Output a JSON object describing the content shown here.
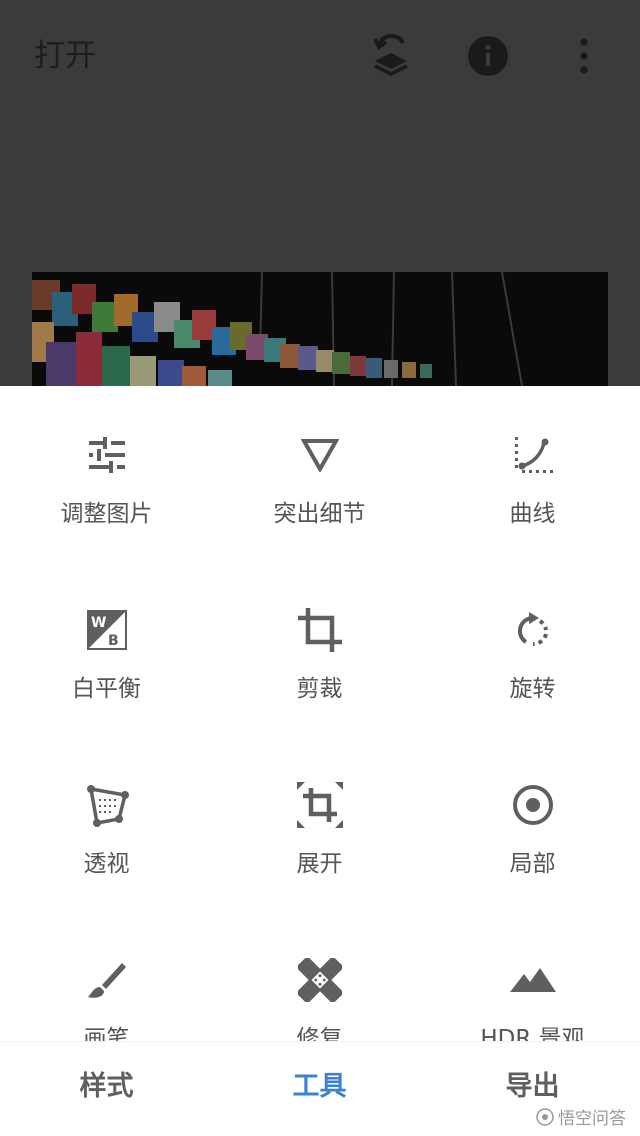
{
  "appbar": {
    "title": "打开",
    "icons": [
      "layers-undo-icon",
      "info-icon",
      "more-vert-icon"
    ]
  },
  "tools": [
    {
      "label": "调整图片",
      "icon": "tune-sliders-icon"
    },
    {
      "label": "突出细节",
      "icon": "details-triangle-icon"
    },
    {
      "label": "曲线",
      "icon": "curves-icon"
    },
    {
      "label": "白平衡",
      "icon": "white-balance-icon"
    },
    {
      "label": "剪裁",
      "icon": "crop-icon"
    },
    {
      "label": "旋转",
      "icon": "rotate-icon"
    },
    {
      "label": "透视",
      "icon": "perspective-icon"
    },
    {
      "label": "展开",
      "icon": "expand-icon"
    },
    {
      "label": "局部",
      "icon": "selective-icon"
    },
    {
      "label": "画笔",
      "icon": "brush-icon"
    },
    {
      "label": "修复",
      "icon": "healing-icon"
    },
    {
      "label": "HDR 景观",
      "icon": "hdr-landscape-icon"
    }
  ],
  "nav": {
    "tabs": [
      "样式",
      "工具",
      "导出"
    ],
    "active": "工具"
  },
  "watermark": "悟空问答",
  "colors": {
    "accent": "#3b82d0",
    "icon": "#5f5f5f",
    "dim_overlay": "#3b3b3b"
  }
}
